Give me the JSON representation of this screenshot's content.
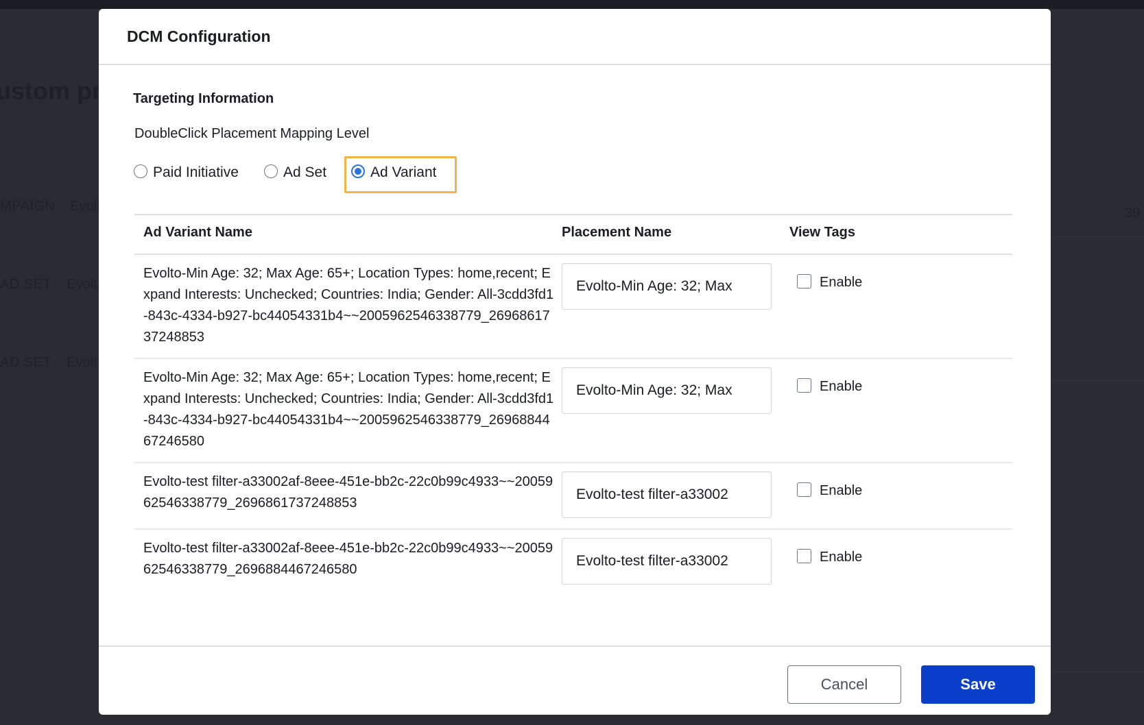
{
  "background": {
    "heading": "ustom pr",
    "rows": [
      {
        "tag": "MPAIGN",
        "value": "Evolt"
      },
      {
        "tag": "AD SET",
        "value": "Evolt"
      },
      {
        "tag": "AD SET",
        "value": "Evolt"
      }
    ],
    "right_value": "39"
  },
  "modal": {
    "title": "DCM Configuration",
    "section_title": "Targeting Information",
    "mapping_label": "DoubleClick Placement Mapping Level",
    "radio_options": [
      {
        "label": "Paid Initiative",
        "checked": false
      },
      {
        "label": "Ad Set",
        "checked": false
      },
      {
        "label": "Ad Variant",
        "checked": true
      }
    ],
    "table": {
      "headers": [
        "Ad Variant Name",
        "Placement Name",
        "View Tags"
      ],
      "rows": [
        {
          "name": "Evolto-Min Age: 32; Max Age: 65+; Location Types: home,recent; Expand Interests: Unchecked; Countries: India; Gender: All-3cdd3fd1-843c-4334-b927-bc44054331b4~~2005962546338779_2696861737248853",
          "placement": "Evolto-Min Age: 32; Max",
          "enable_label": "Enable",
          "enabled": false
        },
        {
          "name": "Evolto-Min Age: 32; Max Age: 65+; Location Types: home,recent; Expand Interests: Unchecked; Countries: India; Gender: All-3cdd3fd1-843c-4334-b927-bc44054331b4~~2005962546338779_2696884467246580",
          "placement": "Evolto-Min Age: 32; Max",
          "enable_label": "Enable",
          "enabled": false
        },
        {
          "name": "Evolto-test filter-a33002af-8eee-451e-bb2c-22c0b99c4933~~2005962546338779_2696861737248853",
          "placement": "Evolto-test filter-a33002",
          "enable_label": "Enable",
          "enabled": false
        },
        {
          "name": "Evolto-test filter-a33002af-8eee-451e-bb2c-22c0b99c4933~~2005962546338779_2696884467246580",
          "placement": "Evolto-test filter-a33002",
          "enable_label": "Enable",
          "enabled": false
        }
      ]
    },
    "buttons": {
      "cancel": "Cancel",
      "save": "Save"
    }
  },
  "colors": {
    "accent": "#0a3fcc",
    "radio_selected": "#2673e6",
    "highlight": "#f0b544"
  }
}
